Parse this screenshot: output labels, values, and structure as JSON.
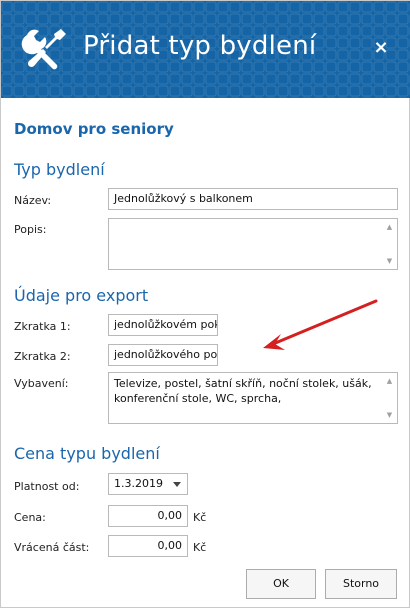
{
  "dialog": {
    "title": "Přidat typ bydlení",
    "close_glyph": "×",
    "icon": "wrench-screwdriver-icon"
  },
  "organization": "Domov pro seniory",
  "section_housing": {
    "title": "Typ bydlení",
    "name_label": "Název:",
    "name_value": "Jednolůžkový s balkonem",
    "description_label": "Popis:",
    "description_value": ""
  },
  "section_export": {
    "title": "Údaje pro export",
    "abbr1_label": "Zkratka 1:",
    "abbr1_value": "jednolůžkovém pokoji",
    "abbr2_label": "Zkratka 2:",
    "abbr2_value": "jednolůžkového pokoj",
    "equipment_label": "Vybavení:",
    "equipment_value": "Televize, postel, šatní skříň, noční stolek, ušák, konferenční stole, WC, sprcha,"
  },
  "section_price": {
    "title": "Cena typu bydlení",
    "valid_from_label": "Platnost od:",
    "valid_from_value": "1.3.2019",
    "price_label": "Cena:",
    "price_value": "0,00",
    "price_unit": "Kč",
    "refund_label": "Vrácená část:",
    "refund_value": "0,00",
    "refund_unit": "Kč"
  },
  "buttons": {
    "ok": "OK",
    "cancel": "Storno"
  },
  "colors": {
    "title_bar": "#1565a6",
    "accent_text": "#1a66ad",
    "annotation_arrow": "#d42020"
  }
}
